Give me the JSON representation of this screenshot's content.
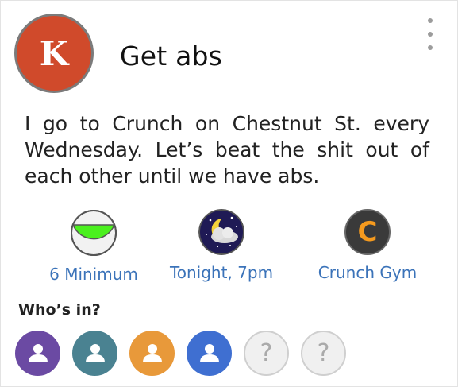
{
  "event": {
    "avatar_letter": "K",
    "title": "Get abs",
    "description": "I go to Crunch on Chestnut St. every Wednesday.  Let’s beat the shit out of each other until we have abs."
  },
  "info": {
    "minimum_label": "6 Minimum",
    "time_label": "Tonight, 7pm",
    "place_label": "Crunch Gym",
    "place_icon_letter": "C"
  },
  "attendees": {
    "heading": "Who’s in?",
    "people": [
      {
        "color": "#6b4aa3"
      },
      {
        "color": "#4a8291"
      },
      {
        "color": "#e8993a"
      },
      {
        "color": "#3f6fd1"
      }
    ],
    "unknown_slot_symbol": "?"
  },
  "colors": {
    "accent": "#3b73b9",
    "avatar_bg": "#d04a2b"
  }
}
